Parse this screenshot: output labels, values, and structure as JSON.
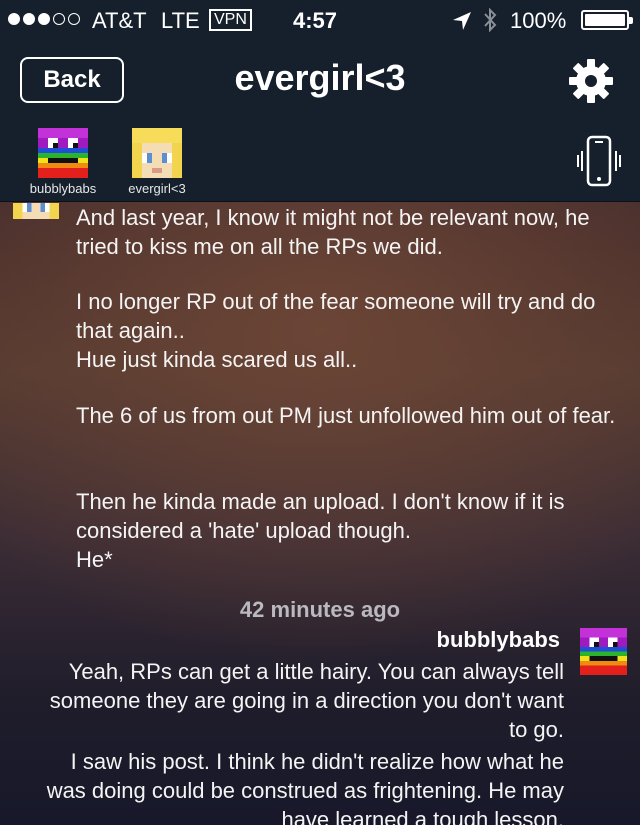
{
  "status_bar": {
    "carrier": "AT&T",
    "network": "LTE",
    "vpn": "VPN",
    "time": "4:57",
    "battery": "100%",
    "signal_bars_filled": 3,
    "signal_bars_total": 5
  },
  "nav": {
    "back_label": "Back",
    "title": "evergirl<3",
    "participants": [
      {
        "name": "bubblybabs",
        "avatar": "rainbow-pixel-avatar"
      },
      {
        "name": "evergirl<3",
        "avatar": "blonde-pixel-avatar"
      }
    ]
  },
  "messages": [
    {
      "sender": "evergirl<3",
      "side": "left",
      "paragraphs": [
        "And last year, I know it might not be relevant now, he tried to kiss me on all the RPs we did.",
        "I no longer RP out of the fear someone will try and do that again..\nHue just kinda scared us all..",
        "The 6 of us from out PM just unfollowed him out of fear.",
        "Then he kinda made an upload. I don't know if it is considered a 'hate' upload though.\nHe*"
      ]
    }
  ],
  "timestamp": "42 minutes ago",
  "reply": {
    "sender": "bubblybabs",
    "paragraphs": [
      "Yeah, RPs can get a little hairy.  You can always tell someone they are going in a direction you don't want to go.",
      "I saw his post.  I think he didn't realize how what he was doing could be construed as frightening.  He may have learned a tough lesson."
    ]
  },
  "colors": {
    "nav_background": "#15202c",
    "text": "#ffffff",
    "timestamp": "#b9b9bf"
  }
}
